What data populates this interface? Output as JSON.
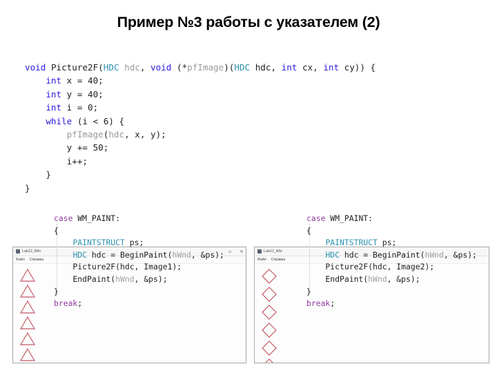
{
  "slide": {
    "title": "Пример №3 работы с указателем (2)",
    "background": "#ffffff"
  },
  "colors": {
    "keyword": "#2b18e0",
    "type": "#2b91af",
    "dim_identifier": "#9a9a9a",
    "case_break": "#8f3f9e",
    "text": "#1f1f1f",
    "shape_stroke": "#c35a62",
    "window_border": "#a6a6a6"
  },
  "main_code": {
    "language": "C",
    "lines": [
      "void Picture2F(HDC hdc, void (*pfImage)(HDC hdc, int cx, int cy)) {",
      "    int x = 40;",
      "    int y = 40;",
      "    int i = 0;",
      "    while (i < 6) {",
      "        pfImage(hdc, x, y);",
      "        y += 50;",
      "        i++;",
      "    }",
      "}"
    ],
    "tokens": [
      [
        {
          "t": "void",
          "c": "kw"
        },
        {
          "t": " ",
          "c": "pun"
        },
        {
          "t": "Picture2F",
          "c": "id"
        },
        {
          "t": "(",
          "c": "pun"
        },
        {
          "t": "HDC",
          "c": "typ"
        },
        {
          "t": " ",
          "c": "pun"
        },
        {
          "t": "hdc",
          "c": "dim"
        },
        {
          "t": ", ",
          "c": "pun"
        },
        {
          "t": "void",
          "c": "kw"
        },
        {
          "t": " (*",
          "c": "pun"
        },
        {
          "t": "pfImage",
          "c": "dim"
        },
        {
          "t": ")(",
          "c": "pun"
        },
        {
          "t": "HDC",
          "c": "typ"
        },
        {
          "t": " hdc, ",
          "c": "pun"
        },
        {
          "t": "int",
          "c": "kw"
        },
        {
          "t": " cx, ",
          "c": "pun"
        },
        {
          "t": "int",
          "c": "kw"
        },
        {
          "t": " cy)) {",
          "c": "pun"
        }
      ],
      [
        {
          "t": "    ",
          "c": "pun"
        },
        {
          "t": "int",
          "c": "kw"
        },
        {
          "t": " x = 40;",
          "c": "pun"
        }
      ],
      [
        {
          "t": "    ",
          "c": "pun"
        },
        {
          "t": "int",
          "c": "kw"
        },
        {
          "t": " y = 40;",
          "c": "pun"
        }
      ],
      [
        {
          "t": "    ",
          "c": "pun"
        },
        {
          "t": "int",
          "c": "kw"
        },
        {
          "t": " i = 0;",
          "c": "pun"
        }
      ],
      [
        {
          "t": "    ",
          "c": "pun"
        },
        {
          "t": "while",
          "c": "kw"
        },
        {
          "t": " (i < 6) {",
          "c": "pun"
        }
      ],
      [
        {
          "t": "        ",
          "c": "pun"
        },
        {
          "t": "pfImage",
          "c": "dim"
        },
        {
          "t": "(",
          "c": "pun"
        },
        {
          "t": "hdc",
          "c": "dim"
        },
        {
          "t": ", x, y);",
          "c": "pun"
        }
      ],
      [
        {
          "t": "        y += 50;",
          "c": "pun"
        }
      ],
      [
        {
          "t": "        i++;",
          "c": "pun"
        }
      ],
      [
        {
          "t": "    }",
          "c": "pun"
        }
      ],
      [
        {
          "t": "}",
          "c": "pun"
        }
      ]
    ]
  },
  "sub_code_left": {
    "lines": [
      "case WM_PAINT:",
      "{",
      "    PAINTSTRUCT ps;",
      "    HDC hdc = BeginPaint(hWnd, &ps);",
      "    Picture2F(hdc, Image1);",
      "    EndPaint(hWnd, &ps);",
      "}",
      "break;"
    ],
    "tokens": [
      [
        {
          "t": "case",
          "c": "pnk"
        },
        {
          "t": " WM_PAINT:",
          "c": "pun"
        }
      ],
      [
        {
          "t": "{",
          "c": "pun"
        }
      ],
      [
        {
          "t": "    ",
          "c": "pun"
        },
        {
          "t": "PAINTSTRUCT",
          "c": "typ"
        },
        {
          "t": " ps;",
          "c": "pun"
        }
      ],
      [
        {
          "t": "    ",
          "c": "pun"
        },
        {
          "t": "HDC",
          "c": "typ"
        },
        {
          "t": " hdc = BeginPaint(",
          "c": "pun"
        },
        {
          "t": "hWnd",
          "c": "gry"
        },
        {
          "t": ", &ps);",
          "c": "pun"
        }
      ],
      [
        {
          "t": "    Picture2F(hdc, Image1);",
          "c": "pun"
        }
      ],
      [
        {
          "t": "    EndPaint(",
          "c": "pun"
        },
        {
          "t": "hWnd",
          "c": "gry"
        },
        {
          "t": ", &ps);",
          "c": "pun"
        }
      ],
      [
        {
          "t": "}",
          "c": "pun"
        }
      ],
      [
        {
          "t": "break",
          "c": "pnk"
        },
        {
          "t": ";",
          "c": "pun"
        }
      ]
    ]
  },
  "sub_code_right": {
    "lines": [
      "case WM_PAINT:",
      "{",
      "    PAINTSTRUCT ps;",
      "    HDC hdc = BeginPaint(hWnd, &ps);",
      "    Picture2F(hdc, Image2);",
      "    EndPaint(hWnd, &ps);",
      "}",
      "break;"
    ],
    "tokens": [
      [
        {
          "t": "case",
          "c": "pnk"
        },
        {
          "t": " WM_PAINT:",
          "c": "pun"
        }
      ],
      [
        {
          "t": "{",
          "c": "pun"
        }
      ],
      [
        {
          "t": "    ",
          "c": "pun"
        },
        {
          "t": "PAINTSTRUCT",
          "c": "typ"
        },
        {
          "t": " ps;",
          "c": "pun"
        }
      ],
      [
        {
          "t": "    ",
          "c": "pun"
        },
        {
          "t": "HDC",
          "c": "typ"
        },
        {
          "t": " hdc = BeginPaint(",
          "c": "pun"
        },
        {
          "t": "hWnd",
          "c": "gry"
        },
        {
          "t": ", &ps);",
          "c": "pun"
        }
      ],
      [
        {
          "t": "    Picture2F(hdc, Image2);",
          "c": "pun"
        }
      ],
      [
        {
          "t": "    EndPaint(",
          "c": "pun"
        },
        {
          "t": "hWnd",
          "c": "gry"
        },
        {
          "t": ", &ps);",
          "c": "pun"
        }
      ],
      [
        {
          "t": "}",
          "c": "pun"
        }
      ],
      [
        {
          "t": "break",
          "c": "pnk"
        },
        {
          "t": ";",
          "c": "pun"
        }
      ]
    ]
  },
  "window_left": {
    "title": "Lab12_Win",
    "menu": [
      "Файл",
      "Справка"
    ],
    "controls": [
      "minimize",
      "close"
    ],
    "control_glyphs": [
      "▫",
      "✕"
    ],
    "shape": "triangle",
    "shape_count": 6,
    "shape_color": "#c35a62"
  },
  "window_right": {
    "title": "Lab12_Win",
    "menu": [
      "Файл",
      "Справка"
    ],
    "controls": [],
    "control_glyphs": [],
    "shape": "diamond",
    "shape_count": 6,
    "shape_color": "#c35a62"
  }
}
